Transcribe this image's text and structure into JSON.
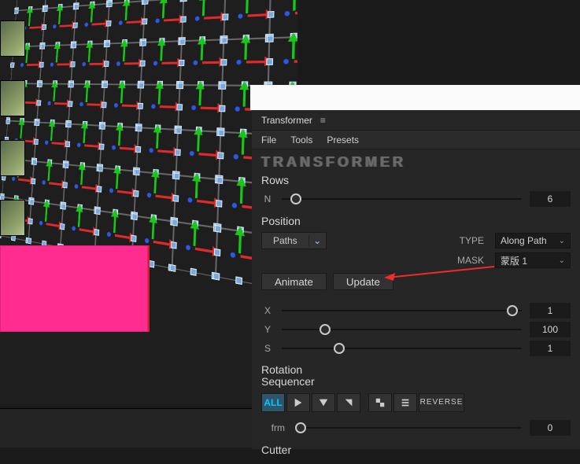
{
  "panel": {
    "title": "Transformer",
    "menu": [
      "File",
      "Tools",
      "Presets"
    ],
    "brand": "TRANSFORMER"
  },
  "rows": {
    "heading": "Rows",
    "n_label": "N",
    "n_value": "6",
    "n_slider_pct": 6
  },
  "position": {
    "heading": "Position",
    "paths_label": "Paths",
    "type_label": "TYPE",
    "type_value": "Along Path",
    "mask_label": "MASK",
    "mask_value": "蒙版 1",
    "animate_label": "Animate",
    "update_label": "Update",
    "x": {
      "label": "X",
      "value": "1",
      "pct": 96
    },
    "y": {
      "label": "Y",
      "value": "100",
      "pct": 18
    },
    "s": {
      "label": "S",
      "value": "1",
      "pct": 24
    }
  },
  "sequencer": {
    "heading_line1": "Rotation",
    "heading_line2": "Sequencer",
    "all_label": "ALL",
    "reverse_label": "REVERSE",
    "frm_label": "frm",
    "frm_value": "0",
    "frm_pct": 2
  },
  "cutter": {
    "heading": "Cutter"
  },
  "colors": {
    "accent_blue": "#00c8ff",
    "pink": "#ff2d8f",
    "red_arrow": "#f12a2a"
  }
}
